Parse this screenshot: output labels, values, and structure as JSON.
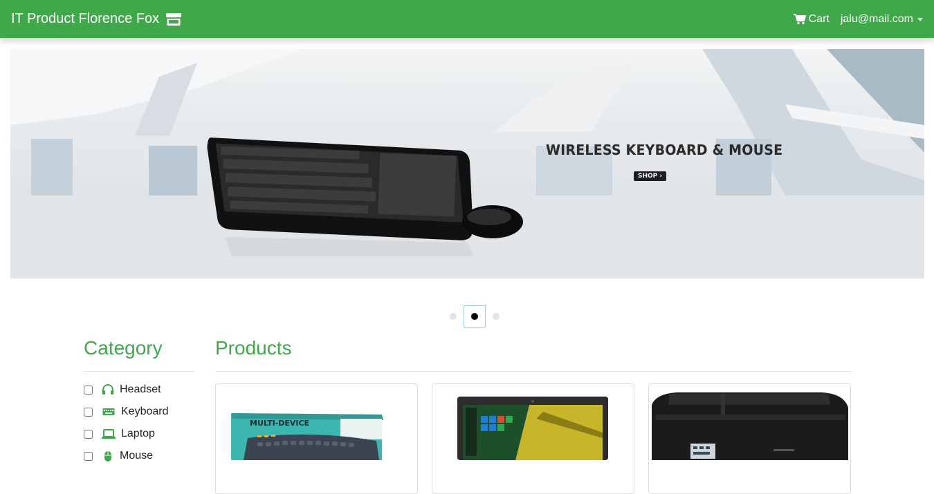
{
  "navbar": {
    "brand": "IT Product Florence Fox",
    "brand_icon": "store-icon",
    "cart_label": "Cart",
    "user_email": "jalu@mail.com"
  },
  "carousel": {
    "heading": "WIRELESS KEYBOARD & MOUSE",
    "button": "SHOP",
    "slide_count": 3,
    "active_slide": 2
  },
  "category": {
    "title": "Category",
    "items": [
      {
        "label": "Headset",
        "icon": "headset-icon",
        "checked": false
      },
      {
        "label": "Keyboard",
        "icon": "keyboard-icon",
        "checked": false
      },
      {
        "label": "Laptop",
        "icon": "laptop-icon",
        "checked": false
      },
      {
        "label": "Mouse",
        "icon": "mouse-icon",
        "checked": false
      }
    ]
  },
  "products": {
    "title": "Products",
    "items": [
      {
        "image": "keyboard-product-image",
        "box_text": "MULTI-DEVICE"
      },
      {
        "image": "laptop-product-image"
      },
      {
        "image": "printer-product-image"
      }
    ]
  },
  "colors": {
    "primary": "#3fa94a"
  }
}
